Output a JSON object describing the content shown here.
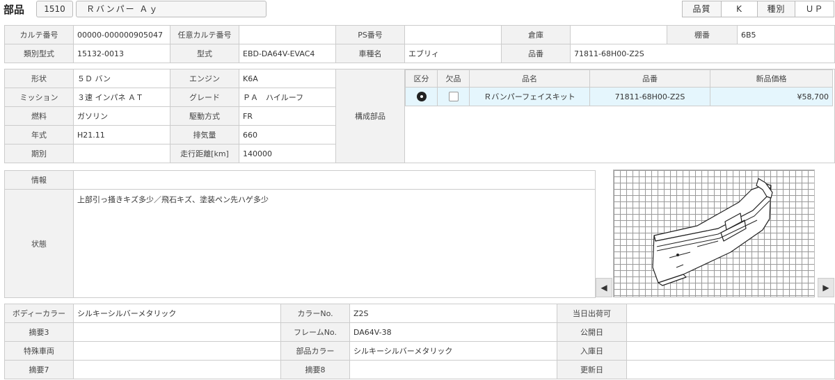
{
  "header": {
    "title": "部品",
    "code": "1510",
    "part_name": "Ｒバンパー Ａｙ",
    "quality_label": "品質",
    "quality_value": "K",
    "type_label": "種別",
    "type_value": "ＵＰ"
  },
  "top": {
    "karte_no_label": "カルテ番号",
    "karte_no": "00000-000000905047",
    "any_karte_label": "任意カルテ番号",
    "any_karte": "",
    "ps_no_label": "PS番号",
    "ps_no": "",
    "warehouse_label": "倉庫",
    "warehouse": "",
    "shelf_label": "棚番",
    "shelf": "6B5",
    "class_model_label": "類別型式",
    "class_model": "15132-0013",
    "model_label": "型式",
    "model": "EBD-DA64V-EVAC4",
    "car_name_label": "車種名",
    "car_name": "エブリィ",
    "part_no_label": "品番",
    "part_no": "71811-68H00-Z2S"
  },
  "spec": {
    "shape_label": "形状",
    "shape": "５Ｄ バン",
    "engine_label": "エンジン",
    "engine": "K6A",
    "mission_label": "ミッション",
    "mission": "３速 インパネ ＡＴ",
    "grade_label": "グレード",
    "grade": "ＰＡ　ハイルーフ",
    "fuel_label": "燃料",
    "fuel": "ガソリン",
    "drive_label": "駆動方式",
    "drive": "FR",
    "year_label": "年式",
    "year": "H21.11",
    "displacement_label": "排気量",
    "displacement": "660",
    "period_label": "期別",
    "period": "",
    "mileage_label": "走行距離[km]",
    "mileage": "140000",
    "components_label": "構成部品"
  },
  "components": {
    "headers": [
      "区分",
      "欠品",
      "品名",
      "品番",
      "新品価格"
    ],
    "rows": [
      {
        "name": "Ｒバンパーフェイスキット",
        "part_no": "71811-68H00-Z2S",
        "price": "¥58,700"
      }
    ]
  },
  "info": {
    "info_label": "情報",
    "info": "",
    "condition_label": "状態",
    "condition": "上部引っ掻きキズ多少／飛石キズ、塗装ペン先ハゲ多少"
  },
  "image_nav": {
    "prev": "◀",
    "next": "▶"
  },
  "bottom": {
    "body_color_label": "ボディーカラー",
    "body_color": "シルキーシルバーメタリック",
    "color_no_label": "カラーNo.",
    "color_no": "Z2S",
    "same_day_label": "当日出荷可",
    "same_day": "",
    "summary3_label": "摘要3",
    "summary3": "",
    "frame_no_label": "フレームNo.",
    "frame_no": "DA64V-38",
    "public_date_label": "公開日",
    "public_date": "",
    "special_label": "特殊車両",
    "special": "",
    "part_color_label": "部品カラー",
    "part_color": "シルキーシルバーメタリック",
    "stock_date_label": "入庫日",
    "stock_date": "",
    "summary7_label": "摘要7",
    "summary7": "",
    "summary8_label": "摘要8",
    "summary8": "",
    "update_date_label": "更新日",
    "update_date": ""
  }
}
